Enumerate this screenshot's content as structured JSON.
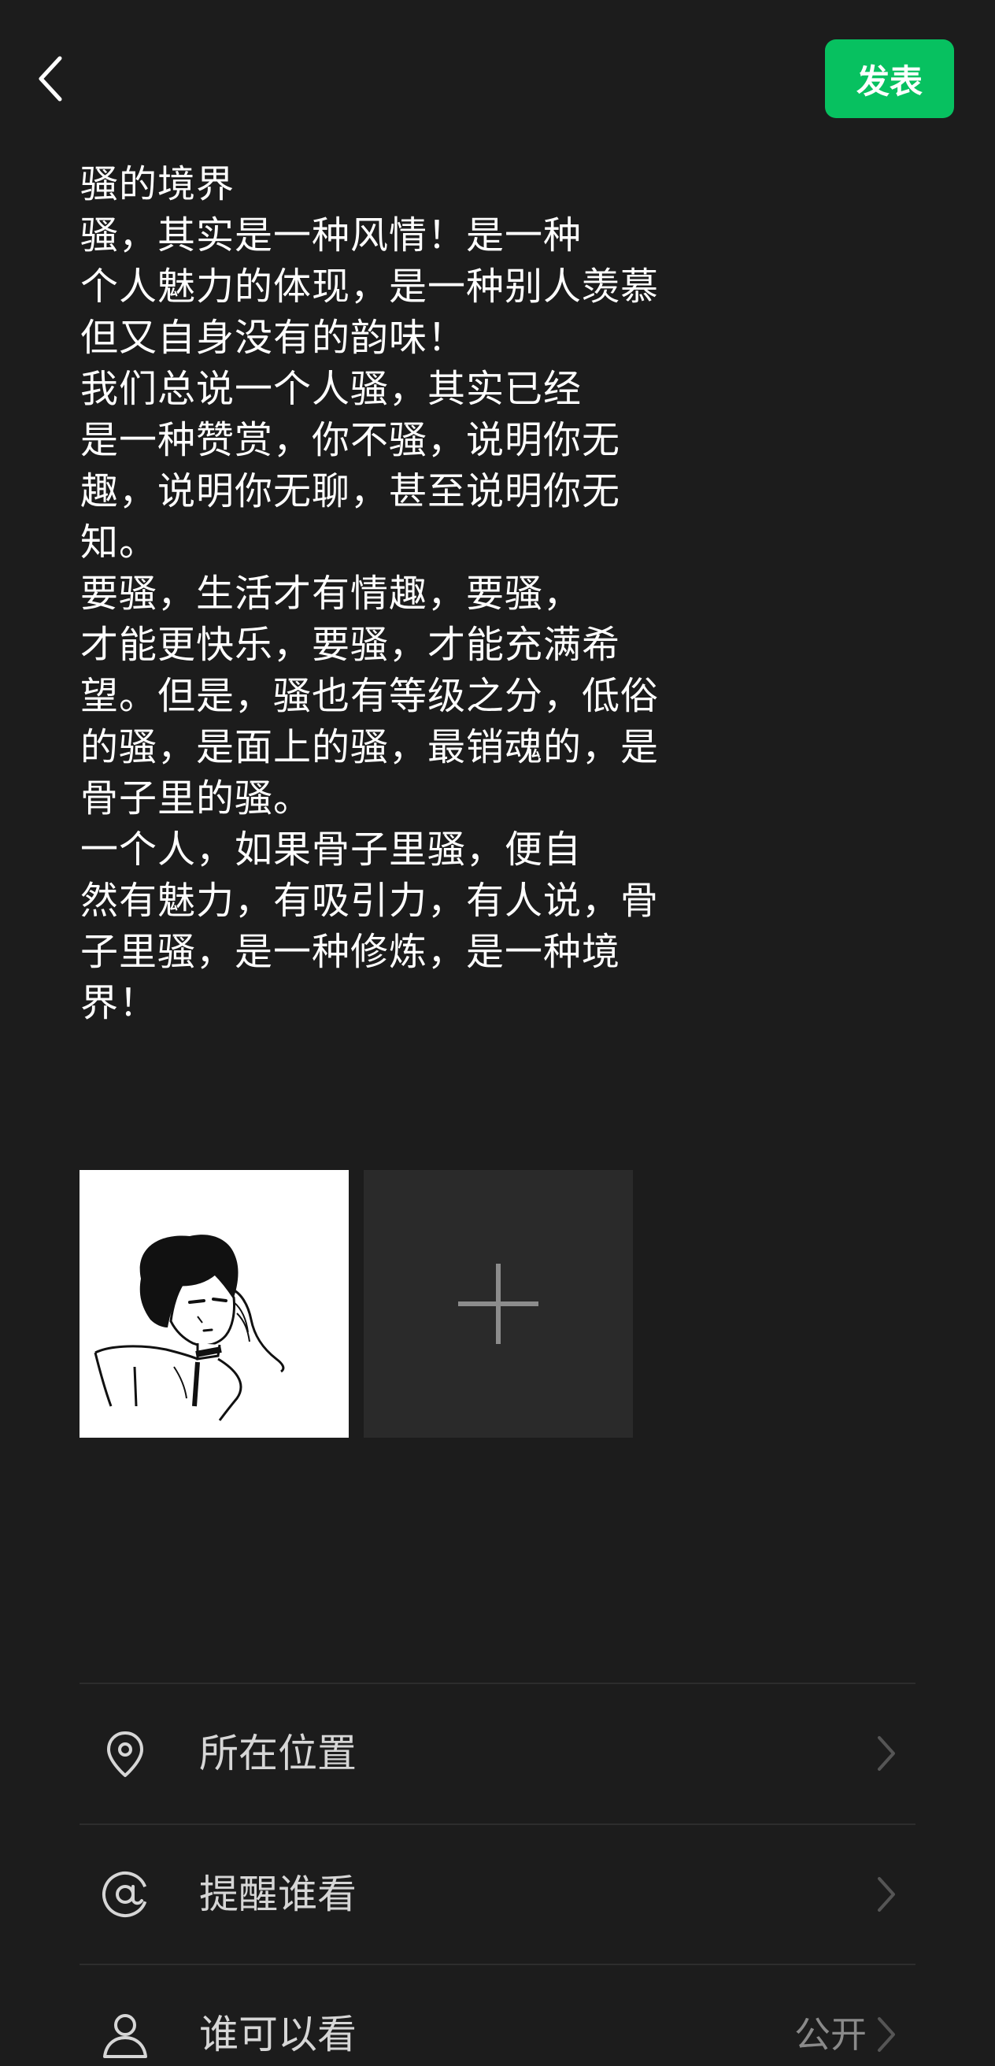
{
  "header": {
    "publish_label": "发表"
  },
  "post": {
    "lines": [
      "骚的境界",
      "骚，其实是一种风情！是一种",
      "个人魅力的体现，是一种别人羡慕",
      "但又自身没有的韵味！",
      "我们总说一个人骚，其实已经",
      "是一种赞赏，你不骚，说明你无",
      "趣，说明你无聊，甚至说明你无",
      "知。",
      "要骚，生活才有情趣，要骚，",
      "才能更快乐，要骚，才能充满希",
      "望。但是，骚也有等级之分，低俗",
      "的骚，是面上的骚，最销魂的，是",
      "骨子里的骚。",
      "一个人，如果骨子里骚，便自",
      "然有魅力，有吸引力，有人说，骨",
      "子里骚，是一种修炼，是一种境",
      "界！"
    ]
  },
  "options": {
    "location": {
      "label": "所在位置",
      "icon": "location-pin-icon"
    },
    "mention": {
      "label": "提醒谁看",
      "icon": "at-icon"
    },
    "visibility": {
      "label": "谁可以看",
      "value": "公开",
      "icon": "person-icon"
    }
  },
  "colors": {
    "background": "#1c1c1c",
    "accent": "#07c160",
    "tile": "#2a2a2a"
  }
}
